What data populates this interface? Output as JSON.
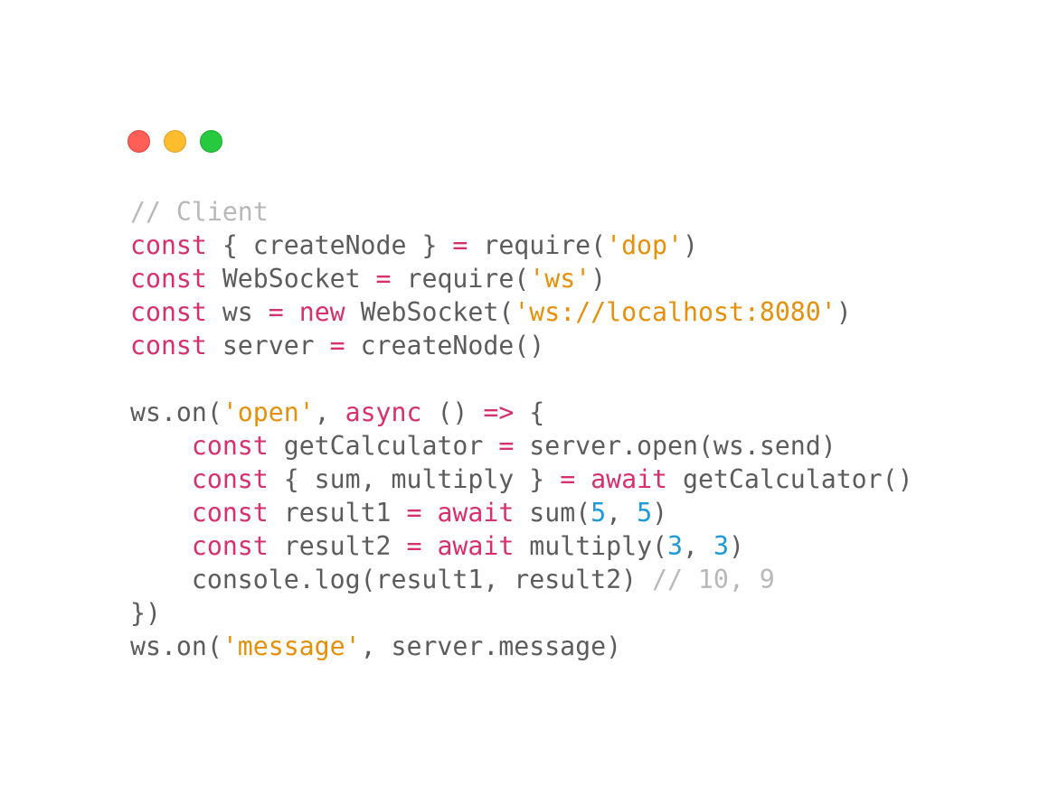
{
  "window": {
    "controls": [
      {
        "name": "close",
        "color": "#ff5f56"
      },
      {
        "name": "minimize",
        "color": "#ffbd2e"
      },
      {
        "name": "zoom",
        "color": "#27c93f"
      }
    ]
  },
  "code": {
    "lines": [
      [
        {
          "t": "// Client",
          "k": "cm"
        }
      ],
      [
        {
          "t": "const",
          "k": "kw"
        },
        {
          "t": " { createNode } ",
          "k": "pl"
        },
        {
          "t": "=",
          "k": "kw"
        },
        {
          "t": " require(",
          "k": "pl"
        },
        {
          "t": "'dop'",
          "k": "str"
        },
        {
          "t": ")",
          "k": "pl"
        }
      ],
      [
        {
          "t": "const",
          "k": "kw"
        },
        {
          "t": " WebSocket ",
          "k": "pl"
        },
        {
          "t": "=",
          "k": "kw"
        },
        {
          "t": " require(",
          "k": "pl"
        },
        {
          "t": "'ws'",
          "k": "str"
        },
        {
          "t": ")",
          "k": "pl"
        }
      ],
      [
        {
          "t": "const",
          "k": "kw"
        },
        {
          "t": " ws ",
          "k": "pl"
        },
        {
          "t": "=",
          "k": "kw"
        },
        {
          "t": " ",
          "k": "pl"
        },
        {
          "t": "new",
          "k": "kw"
        },
        {
          "t": " WebSocket(",
          "k": "pl"
        },
        {
          "t": "'ws://localhost:8080'",
          "k": "str"
        },
        {
          "t": ")",
          "k": "pl"
        }
      ],
      [
        {
          "t": "const",
          "k": "kw"
        },
        {
          "t": " server ",
          "k": "pl"
        },
        {
          "t": "=",
          "k": "kw"
        },
        {
          "t": " createNode()",
          "k": "pl"
        }
      ],
      [],
      [
        {
          "t": "ws.on(",
          "k": "pl"
        },
        {
          "t": "'open'",
          "k": "str"
        },
        {
          "t": ", ",
          "k": "pl"
        },
        {
          "t": "async",
          "k": "kw"
        },
        {
          "t": " () ",
          "k": "pl"
        },
        {
          "t": "=>",
          "k": "kw"
        },
        {
          "t": " {",
          "k": "pl"
        }
      ],
      [
        {
          "t": "    ",
          "k": "pl"
        },
        {
          "t": "const",
          "k": "kw"
        },
        {
          "t": " getCalculator ",
          "k": "pl"
        },
        {
          "t": "=",
          "k": "kw"
        },
        {
          "t": " server.open(ws.send)",
          "k": "pl"
        }
      ],
      [
        {
          "t": "    ",
          "k": "pl"
        },
        {
          "t": "const",
          "k": "kw"
        },
        {
          "t": " { sum, multiply } ",
          "k": "pl"
        },
        {
          "t": "=",
          "k": "kw"
        },
        {
          "t": " ",
          "k": "pl"
        },
        {
          "t": "await",
          "k": "kw"
        },
        {
          "t": " getCalculator()",
          "k": "pl"
        }
      ],
      [
        {
          "t": "    ",
          "k": "pl"
        },
        {
          "t": "const",
          "k": "kw"
        },
        {
          "t": " result1 ",
          "k": "pl"
        },
        {
          "t": "=",
          "k": "kw"
        },
        {
          "t": " ",
          "k": "pl"
        },
        {
          "t": "await",
          "k": "kw"
        },
        {
          "t": " sum(",
          "k": "pl"
        },
        {
          "t": "5",
          "k": "num"
        },
        {
          "t": ", ",
          "k": "pl"
        },
        {
          "t": "5",
          "k": "num"
        },
        {
          "t": ")",
          "k": "pl"
        }
      ],
      [
        {
          "t": "    ",
          "k": "pl"
        },
        {
          "t": "const",
          "k": "kw"
        },
        {
          "t": " result2 ",
          "k": "pl"
        },
        {
          "t": "=",
          "k": "kw"
        },
        {
          "t": " ",
          "k": "pl"
        },
        {
          "t": "await",
          "k": "kw"
        },
        {
          "t": " multiply(",
          "k": "pl"
        },
        {
          "t": "3",
          "k": "num"
        },
        {
          "t": ", ",
          "k": "pl"
        },
        {
          "t": "3",
          "k": "num"
        },
        {
          "t": ")",
          "k": "pl"
        }
      ],
      [
        {
          "t": "    console.log(result1, result2) ",
          "k": "pl"
        },
        {
          "t": "// 10, 9",
          "k": "cm"
        }
      ],
      [
        {
          "t": "})",
          "k": "pl"
        }
      ],
      [
        {
          "t": "ws.on(",
          "k": "pl"
        },
        {
          "t": "'message'",
          "k": "str"
        },
        {
          "t": ", server.message)",
          "k": "pl"
        }
      ]
    ]
  },
  "colors": {
    "keyword": "#d6306f",
    "string": "#e5900b",
    "number": "#1d9bd9",
    "comment": "#b8b8b8",
    "plain": "#5c5c5c",
    "background": "#ffffff"
  }
}
